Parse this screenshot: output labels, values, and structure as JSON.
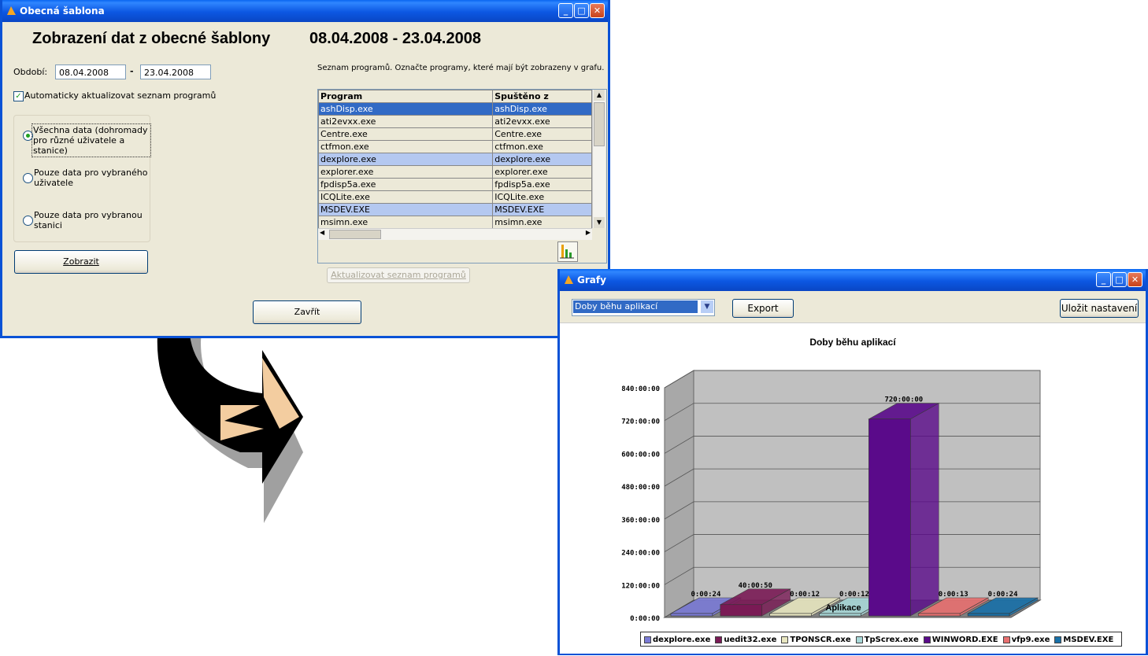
{
  "win1": {
    "title": "Obecná šablona",
    "heading": "Zobrazení dat z obecné šablony",
    "heading_range": "08.04.2008 - 23.04.2008",
    "period_label": "Období:",
    "date_from": "08.04.2008",
    "date_sep": "-",
    "date_to": "23.04.2008",
    "auto_update_label": "Automaticky aktualizovat seznam programů",
    "radio_all_line1": "Všechna data (dohromady",
    "radio_all_line2": "pro různé uživatele a stanice)",
    "radio_user_line1": "Pouze data pro vybraného",
    "radio_user_line2": "uživatele",
    "radio_station_line1": "Pouze data pro vybranou",
    "radio_station_line2": "stanici",
    "show_button": "Zobrazit",
    "list_hint": "Seznam programů. Označte programy, které mají být zobrazeny v grafu.",
    "col_program": "Program",
    "col_started": "Spuštěno z",
    "rows": [
      {
        "program": "ashDisp.exe",
        "started": "ashDisp.exe"
      },
      {
        "program": "ati2evxx.exe",
        "started": "ati2evxx.exe"
      },
      {
        "program": "Centre.exe",
        "started": "Centre.exe"
      },
      {
        "program": "ctfmon.exe",
        "started": "ctfmon.exe"
      },
      {
        "program": "dexplore.exe",
        "started": "dexplore.exe"
      },
      {
        "program": "explorer.exe",
        "started": "explorer.exe"
      },
      {
        "program": "fpdisp5a.exe",
        "started": "fpdisp5a.exe"
      },
      {
        "program": "ICQLite.exe",
        "started": "ICQLite.exe"
      },
      {
        "program": "MSDEV.EXE",
        "started": "MSDEV.EXE"
      },
      {
        "program": "msimn.exe",
        "started": "msimn.exe"
      }
    ],
    "refresh_button": "Aktualizovat seznam programů",
    "close_button": "Zavřít"
  },
  "win2": {
    "title": "Grafy",
    "chart_select": "Doby běhu aplikací",
    "export_button": "Export",
    "save_button": "Uložit nastavení"
  },
  "chart_data": {
    "type": "bar",
    "title": "Doby běhu aplikací",
    "xlabel": "Aplikace",
    "ylabel": "",
    "ylim": [
      0,
      840
    ],
    "yticks": [
      "0:00:00",
      "120:00:00",
      "240:00:00",
      "360:00:00",
      "480:00:00",
      "600:00:00",
      "720:00:00",
      "840:00:00"
    ],
    "categories": [
      "dexplore.exe",
      "uedit32.exe",
      "TPONSCR.exe",
      "TpScrex.exe",
      "WINWORD.EXE",
      "vfp9.exe",
      "MSDEV.EXE"
    ],
    "values": [
      0.11,
      40.98,
      0.2,
      0.2,
      720,
      0.22,
      0.4
    ],
    "labels": [
      "0:00:24",
      "40:00:50",
      "0:00:12",
      "0:00:12",
      "720:00:00",
      "0:00:13",
      "0:00:24"
    ],
    "colors": [
      "#7b7bd6",
      "#7a1a55",
      "#e8e6c0",
      "#a8d8d8",
      "#5a0a8a",
      "#e87070",
      "#1870a8"
    ],
    "grid": true,
    "legend": "bottom"
  }
}
